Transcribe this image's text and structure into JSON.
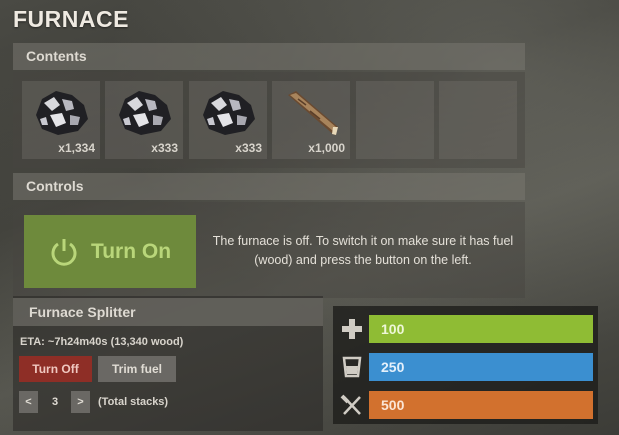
{
  "title": "FURNACE",
  "contents": {
    "header": "Contents",
    "slots": [
      {
        "item": "metal-ore-icon",
        "qty": "x1,334"
      },
      {
        "item": "metal-ore-icon",
        "qty": "x333"
      },
      {
        "item": "metal-ore-icon",
        "qty": "x333"
      },
      {
        "item": "wood-icon",
        "qty": "x1,000"
      },
      {
        "item": "",
        "qty": ""
      },
      {
        "item": "",
        "qty": ""
      }
    ]
  },
  "controls": {
    "header": "Controls",
    "turn_on_label": "Turn On",
    "info": "The furnace is off. To switch it on make sure it has fuel (wood) and press the button on the left."
  },
  "splitter": {
    "header": "Furnace Splitter",
    "eta": "ETA: ~7h24m40s (13,340 wood)",
    "turn_off_label": "Turn Off",
    "trim_fuel_label": "Trim fuel",
    "decrease_label": "<",
    "increase_label": ">",
    "stacks": "3",
    "stacks_label": "(Total stacks)"
  },
  "stats": {
    "health": "100",
    "water": "250",
    "food": "500"
  },
  "colors": {
    "turn_on": "#6e8a3c",
    "turn_off": "#8e2e26",
    "health": "#8fbc34",
    "water": "#3b8fd0",
    "food": "#d2712e"
  }
}
